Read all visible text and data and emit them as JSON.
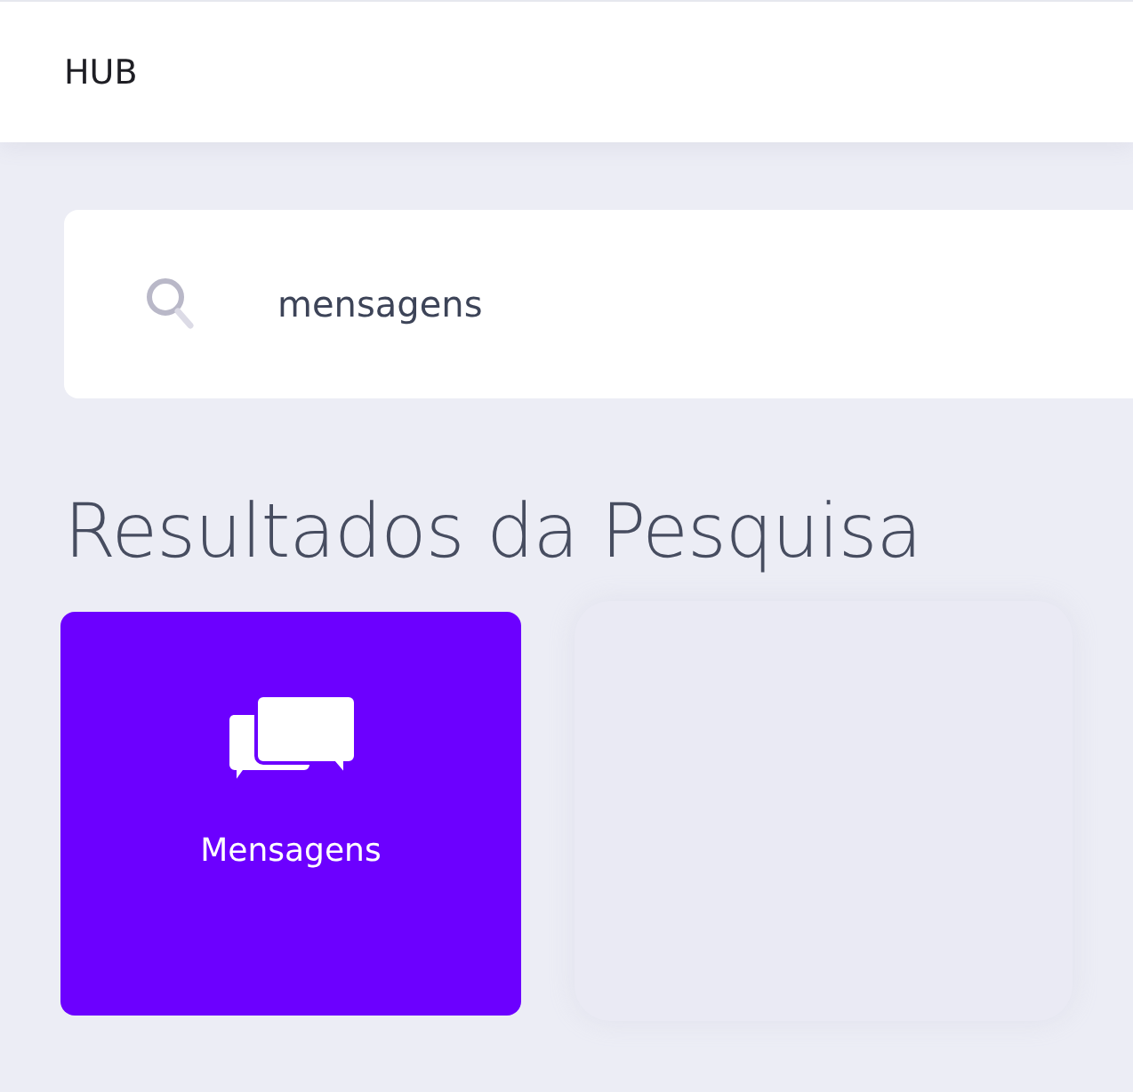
{
  "header": {
    "title": "HUB"
  },
  "search": {
    "value": "mensagens"
  },
  "heading": "Resultados da Pesquisa",
  "results": [
    {
      "label": "Mensagens"
    }
  ]
}
